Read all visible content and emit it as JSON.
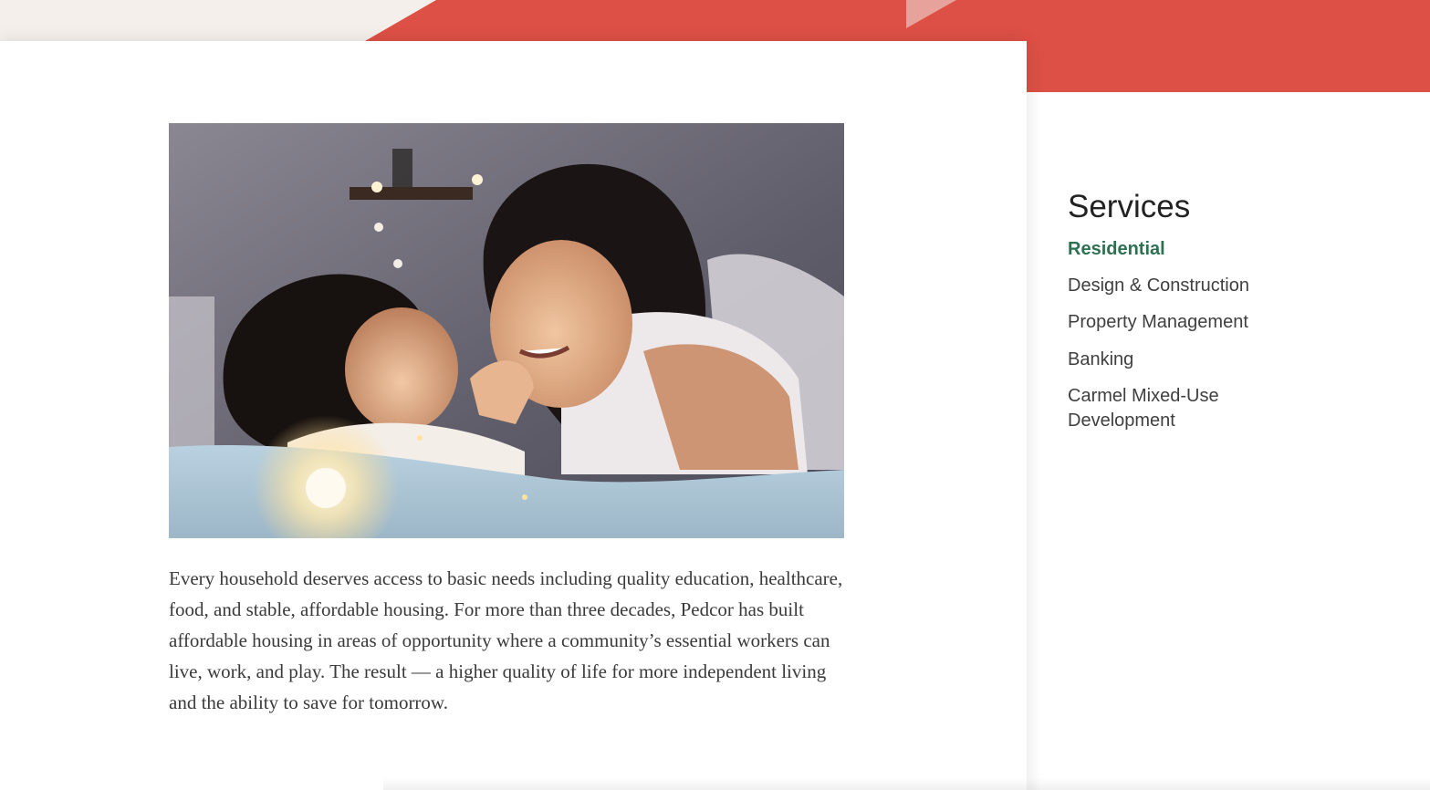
{
  "colors": {
    "brand_red": "#dc5045",
    "accent_green": "#2e7151",
    "page_background": "#f4efea",
    "card_background": "#ffffff",
    "body_text": "#3a3a3a"
  },
  "hero_image": {
    "alt": "Mother and daughter lying on a bed, smiling at each other under warm string lights"
  },
  "body_text": "Every household deserves access to basic needs including quality education, healthcare, food, and stable, affordable housing. For more than three decades, Pedcor has built affordable housing in areas of opportunity where a community’s essential workers can live, work, and play. The result — a higher quality of life for more independent living and the ability to save for tomorrow.",
  "sidebar": {
    "heading": "Services",
    "items": [
      {
        "label": "Residential",
        "active": true
      },
      {
        "label": "Design & Construction",
        "active": false
      },
      {
        "label": "Property Management",
        "active": false
      },
      {
        "label": "Banking",
        "active": false
      },
      {
        "label": "Carmel Mixed-Use Development",
        "active": false
      }
    ]
  }
}
